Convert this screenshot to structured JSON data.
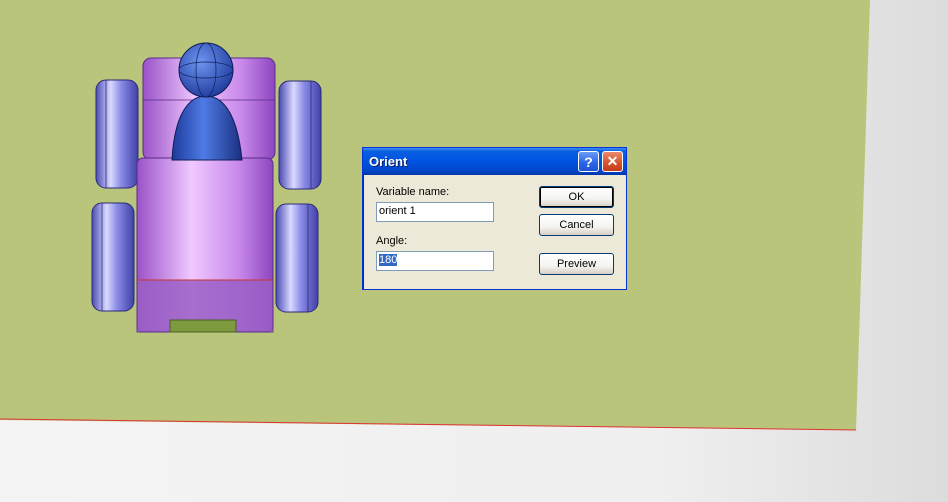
{
  "dialog": {
    "title": "Orient",
    "help_label": "?",
    "close_label": "✕",
    "variable_name_label": "Variable name:",
    "variable_name_value": "orient 1",
    "angle_label": "Angle:",
    "angle_value": "180",
    "ok_label": "OK",
    "cancel_label": "Cancel",
    "preview_label": "Preview"
  },
  "colors": {
    "ground": "#b9c57a",
    "car_body": "#c98ee8",
    "wheel": "#6b6bd6",
    "figure": "#2f4fb8",
    "dialog_bg": "#ece9d8",
    "titlebar": "#0054e3"
  },
  "icons": [
    "help-icon",
    "close-icon"
  ]
}
